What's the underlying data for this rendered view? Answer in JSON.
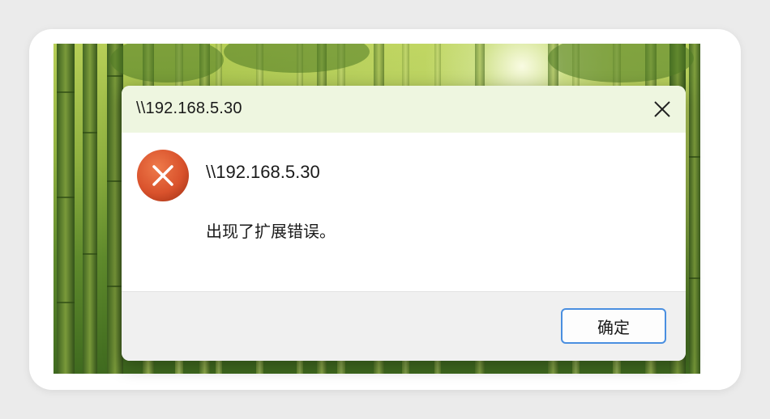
{
  "dialog": {
    "window_title": "\\\\192.168.5.30",
    "message_title": "\\\\192.168.5.30",
    "message_body": "出现了扩展错误。",
    "ok_label": "确定",
    "icon": "error-icon",
    "close_icon": "close-icon"
  },
  "colors": {
    "titlebar": "#eef6e0",
    "error_red": "#d9522c",
    "footer": "#f0f0f0",
    "button_border": "#4a8fe0"
  }
}
